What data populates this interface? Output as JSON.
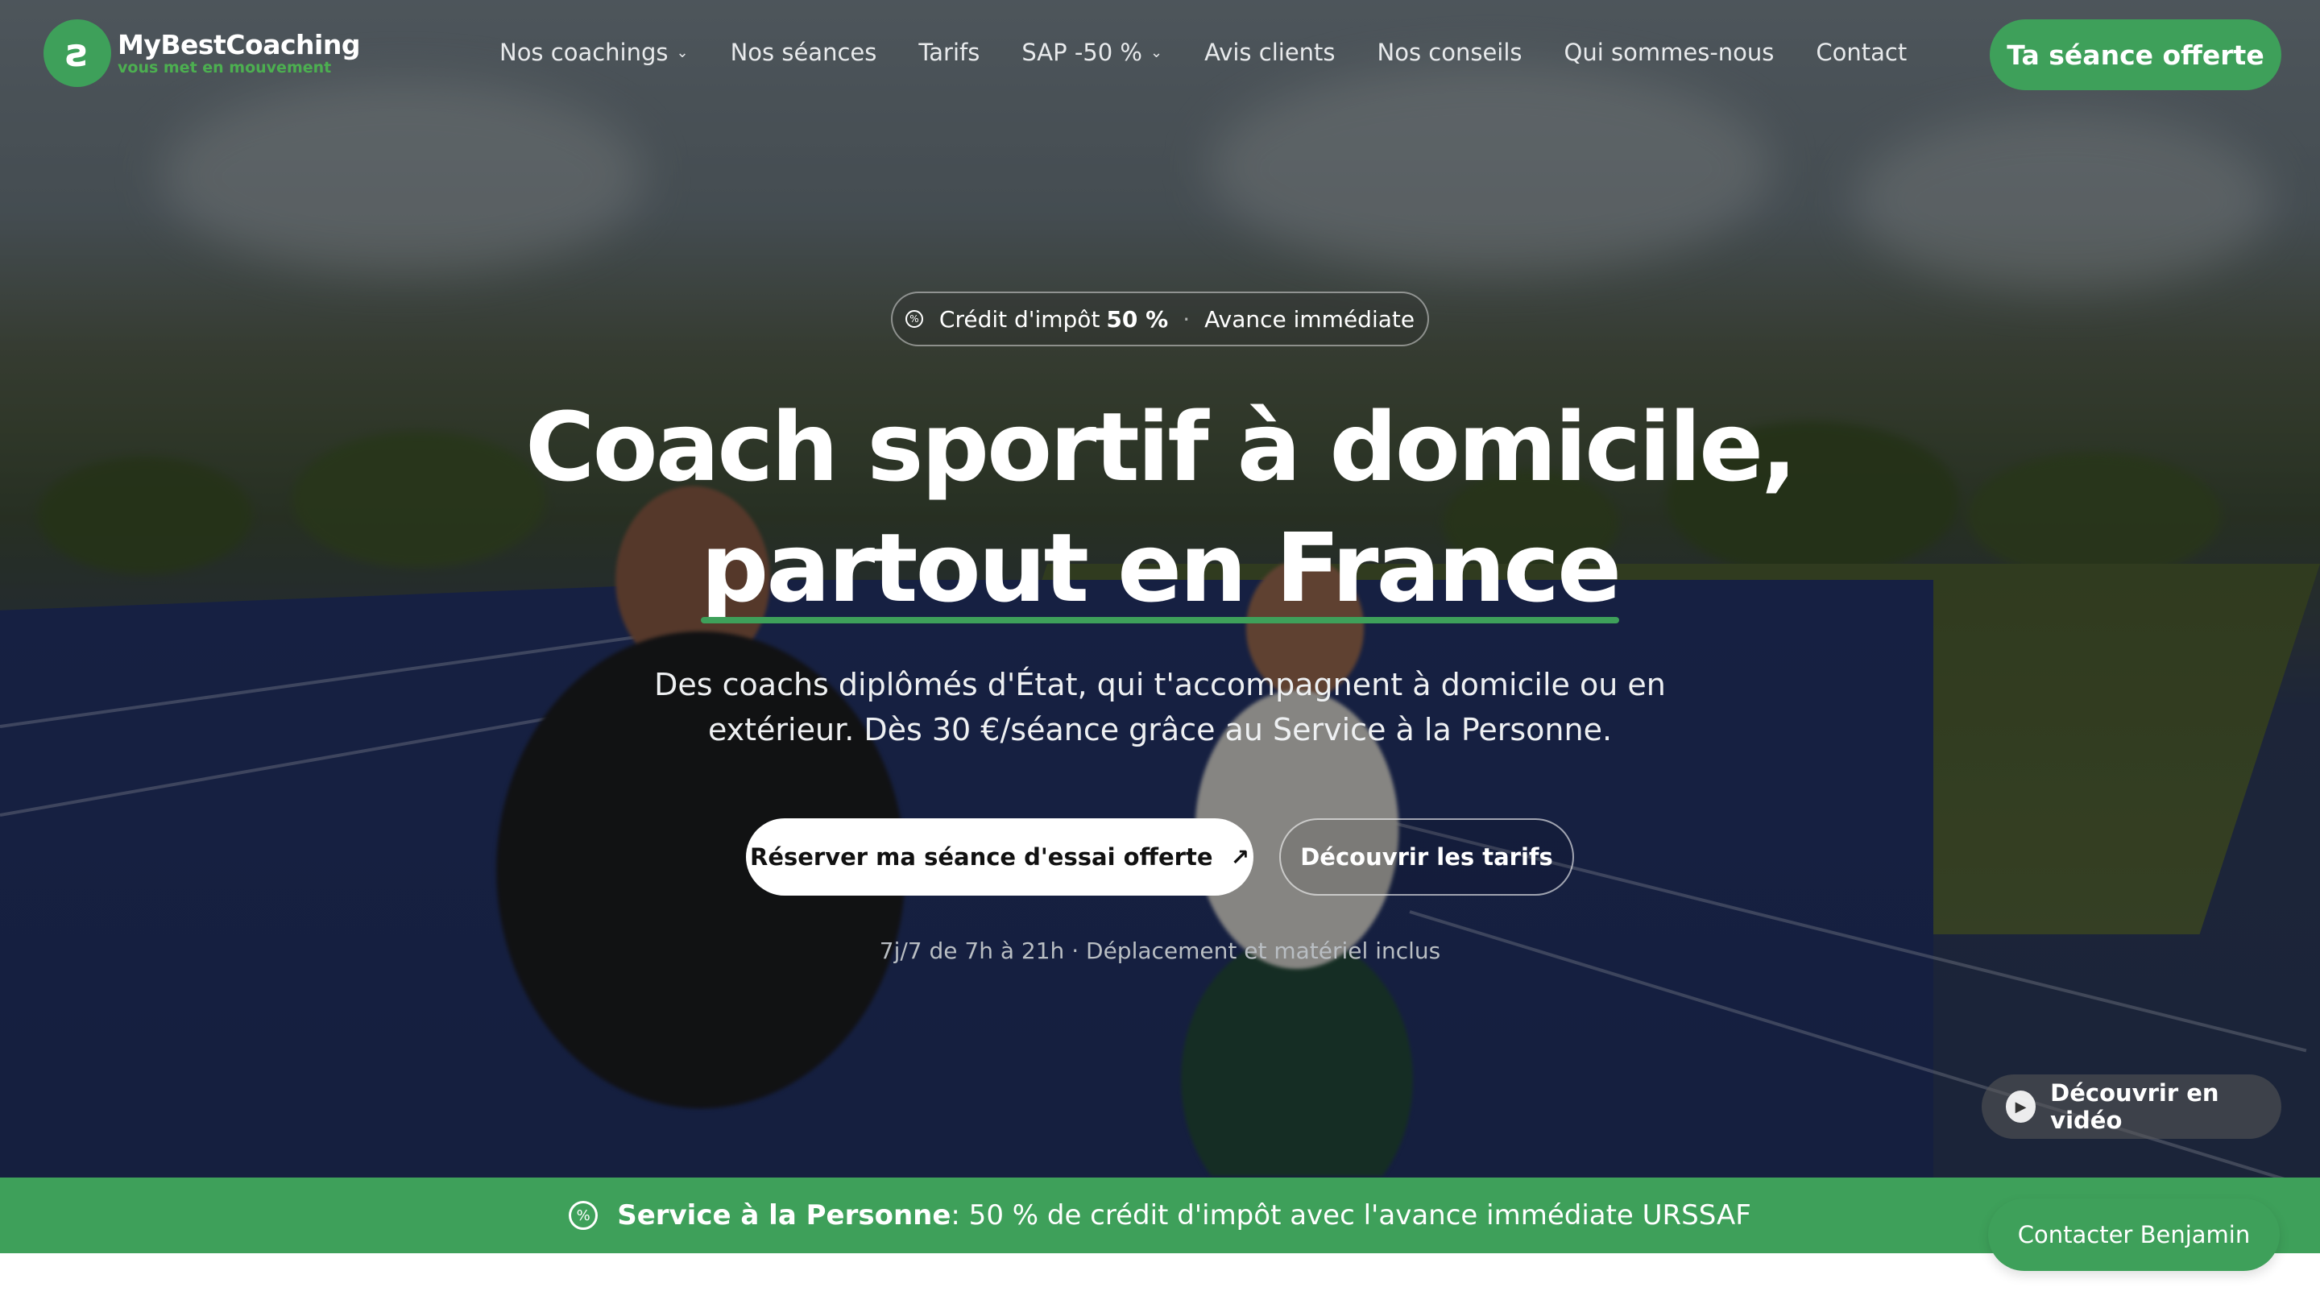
{
  "header": {
    "logo_name": "MyBestCoaching",
    "logo_tagline": "vous met en mouvement",
    "nav": [
      {
        "label": "Nos coachings",
        "has_dropdown": true
      },
      {
        "label": "Nos séances",
        "has_dropdown": false
      },
      {
        "label": "Tarifs",
        "has_dropdown": false
      },
      {
        "label": "SAP -50 %",
        "has_dropdown": true
      },
      {
        "label": "Avis clients",
        "has_dropdown": false
      },
      {
        "label": "Nos conseils",
        "has_dropdown": false
      },
      {
        "label": "Qui sommes-nous",
        "has_dropdown": false
      },
      {
        "label": "Contact",
        "has_dropdown": false
      }
    ],
    "cta_label": "Ta séance offerte"
  },
  "hero": {
    "pill_text": "Crédit d'impôt",
    "pill_value": "50 %",
    "pill_extra": "Avance immédiate",
    "title_line1": "Coach sportif à domicile,",
    "title_line2": "partout en France",
    "subtitle": "Des coachs diplômés d'État, qui t'accompagnent à domicile ou en extérieur. Dès 30 €/séance grâce au Service à la Personne.",
    "primary_button": "Réserver ma séance d'essai offerte",
    "secondary_button": "Découvrir les tarifs",
    "meta": "7j/7 de 7h à 21h · Déplacement et matériel inclus",
    "video_button": "Découvrir en vidéo"
  },
  "banner": {
    "bold": "Service à la Personne",
    "text": ": 50 % de crédit d'impôt avec l'avance immédiate URSSAF"
  },
  "contact_button": "Contacter Benjamin",
  "colors": {
    "accent": "#3ea05a",
    "text_light": "#ffffff"
  }
}
